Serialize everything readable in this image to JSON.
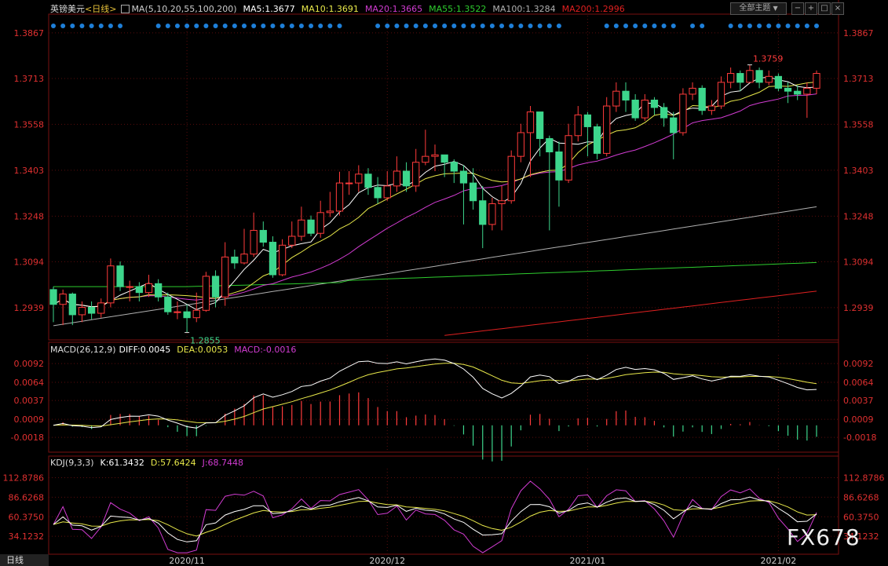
{
  "header": {
    "symbol": "英镑美元",
    "period": "<日线>",
    "ma_label": "MA(5,10,20,55,100,200)",
    "ma5": "MA5:1.3677",
    "ma10": "MA10:1.3691",
    "ma20": "MA20:1.3665",
    "ma55": "MA55:1.3522",
    "ma100": "MA100:1.3284",
    "ma200": "MA200:1.2996",
    "theme_button": "全部主题",
    "theme_arrow": "▼",
    "ctrl_minus": "−",
    "ctrl_plus": "+",
    "ctrl_max": "□",
    "ctrl_close": "×"
  },
  "macd_header": {
    "name": "MACD(26,12,9)",
    "diff": "DIFF:0.0045",
    "dea": "DEA:0.0053",
    "macd": "MACD:-0.0016"
  },
  "kdj_header": {
    "name": "KDJ(9,3,3)",
    "k": "K:61.3432",
    "d": "D:57.6424",
    "j": "J:68.7448"
  },
  "bottom_tab": "日线",
  "watermark": "FX678",
  "colors": {
    "up": "#ff3b3b",
    "down": "#3dd68c",
    "ma5": "#ffffff",
    "ma10": "#e8e84a",
    "ma20": "#d23cd2",
    "ma55": "#2ecc2e",
    "ma100": "#b0b0b0",
    "ma200": "#e02020",
    "dots": "#1e7fd8",
    "grid": "#7a1010",
    "axis_text": "#e03030"
  },
  "chart_data": {
    "type": "candlestick",
    "price_axis": {
      "ticks": [
        1.3867,
        1.3713,
        1.3558,
        1.3403,
        1.3248,
        1.3094,
        1.2939
      ],
      "tick_labels": [
        "1.3867",
        "1.3713",
        "1.3558",
        "1.3403",
        "1.3248",
        "1.3094",
        "1.2939"
      ],
      "ylim": [
        1.283,
        1.3925
      ]
    },
    "x_labels": [
      {
        "label": "2020/11",
        "index": 14
      },
      {
        "label": "2020/12",
        "index": 35
      },
      {
        "label": "2021/01",
        "index": 56
      },
      {
        "label": "2021/02",
        "index": 76
      }
    ],
    "annotations": [
      {
        "text": "1.2855",
        "type": "low"
      },
      {
        "text": "1.3759",
        "type": "high"
      }
    ],
    "candles": [
      [
        1.3,
        1.295,
        1.301,
        1.289
      ],
      [
        1.295,
        1.2985,
        1.3,
        1.288
      ],
      [
        1.2985,
        1.2915,
        1.299,
        1.288
      ],
      [
        1.2915,
        1.294,
        1.296,
        1.289
      ],
      [
        1.294,
        1.292,
        1.296,
        1.29
      ],
      [
        1.292,
        1.2955,
        1.297,
        1.2905
      ],
      [
        1.2955,
        1.308,
        1.3105,
        1.294
      ],
      [
        1.308,
        1.301,
        1.3095,
        1.2995
      ],
      [
        1.301,
        1.301,
        1.303,
        1.296
      ],
      [
        1.301,
        1.299,
        1.3025,
        1.296
      ],
      [
        1.299,
        1.302,
        1.305,
        1.2975
      ],
      [
        1.302,
        1.2975,
        1.3035,
        1.296
      ],
      [
        1.2975,
        1.2925,
        1.299,
        1.2915
      ],
      [
        1.2925,
        1.2925,
        1.296,
        1.29
      ],
      [
        1.2925,
        1.2905,
        1.295,
        1.2855
      ],
      [
        1.2905,
        1.293,
        1.299,
        1.289
      ],
      [
        1.293,
        1.3045,
        1.306,
        1.2925
      ],
      [
        1.3045,
        1.2975,
        1.3065,
        1.294
      ],
      [
        1.2975,
        1.311,
        1.316,
        1.2945
      ],
      [
        1.311,
        1.309,
        1.3135,
        1.307
      ],
      [
        1.309,
        1.312,
        1.3205,
        1.3085
      ],
      [
        1.312,
        1.32,
        1.326,
        1.311
      ],
      [
        1.32,
        1.316,
        1.323,
        1.3145
      ],
      [
        1.316,
        1.305,
        1.318,
        1.304
      ],
      [
        1.305,
        1.315,
        1.317,
        1.3045
      ],
      [
        1.315,
        1.318,
        1.323,
        1.314
      ],
      [
        1.318,
        1.3235,
        1.328,
        1.3165
      ],
      [
        1.3235,
        1.319,
        1.325,
        1.318
      ],
      [
        1.319,
        1.326,
        1.33,
        1.3175
      ],
      [
        1.326,
        1.3265,
        1.333,
        1.3245
      ],
      [
        1.3265,
        1.336,
        1.3398,
        1.325
      ],
      [
        1.336,
        1.336,
        1.34,
        1.332
      ],
      [
        1.336,
        1.339,
        1.342,
        1.333
      ],
      [
        1.339,
        1.3345,
        1.341,
        1.332
      ],
      [
        1.3345,
        1.331,
        1.338,
        1.329
      ],
      [
        1.331,
        1.335,
        1.34,
        1.33
      ],
      [
        1.335,
        1.34,
        1.345,
        1.333
      ],
      [
        1.34,
        1.335,
        1.343,
        1.333
      ],
      [
        1.335,
        1.343,
        1.3475,
        1.333
      ],
      [
        1.343,
        1.345,
        1.354,
        1.342
      ],
      [
        1.345,
        1.3455,
        1.349,
        1.34
      ],
      [
        1.3455,
        1.343,
        1.345,
        1.338
      ],
      [
        1.343,
        1.34,
        1.344,
        1.336
      ],
      [
        1.34,
        1.336,
        1.342,
        1.322
      ],
      [
        1.336,
        1.33,
        1.341,
        1.327
      ],
      [
        1.33,
        1.322,
        1.335,
        1.314
      ],
      [
        1.322,
        1.329,
        1.331,
        1.32
      ],
      [
        1.329,
        1.33,
        1.335,
        1.32
      ],
      [
        1.33,
        1.345,
        1.347,
        1.329
      ],
      [
        1.345,
        1.353,
        1.356,
        1.343
      ],
      [
        1.353,
        1.36,
        1.362,
        1.338
      ],
      [
        1.36,
        1.351,
        1.36,
        1.345
      ],
      [
        1.351,
        1.3465,
        1.352,
        1.32
      ],
      [
        1.3465,
        1.337,
        1.35,
        1.328
      ],
      [
        1.337,
        1.352,
        1.356,
        1.336
      ],
      [
        1.352,
        1.359,
        1.362,
        1.35
      ],
      [
        1.359,
        1.355,
        1.36,
        1.345
      ],
      [
        1.355,
        1.346,
        1.356,
        1.344
      ],
      [
        1.346,
        1.362,
        1.365,
        1.345
      ],
      [
        1.362,
        1.367,
        1.37,
        1.36
      ],
      [
        1.367,
        1.364,
        1.37,
        1.36
      ],
      [
        1.364,
        1.358,
        1.366,
        1.357
      ],
      [
        1.358,
        1.364,
        1.366,
        1.357
      ],
      [
        1.364,
        1.3615,
        1.365,
        1.359
      ],
      [
        1.3615,
        1.358,
        1.363,
        1.355
      ],
      [
        1.358,
        1.353,
        1.36,
        1.344
      ],
      [
        1.353,
        1.366,
        1.368,
        1.352
      ],
      [
        1.366,
        1.368,
        1.37,
        1.364
      ],
      [
        1.368,
        1.3605,
        1.369,
        1.359
      ],
      [
        1.3605,
        1.362,
        1.364,
        1.359
      ],
      [
        1.362,
        1.37,
        1.372,
        1.361
      ],
      [
        1.37,
        1.373,
        1.375,
        1.368
      ],
      [
        1.373,
        1.37,
        1.374,
        1.367
      ],
      [
        1.37,
        1.374,
        1.3759,
        1.37
      ],
      [
        1.374,
        1.37,
        1.375,
        1.368
      ],
      [
        1.37,
        1.372,
        1.374,
        1.369
      ],
      [
        1.372,
        1.368,
        1.373,
        1.367
      ],
      [
        1.368,
        1.367,
        1.37,
        1.363
      ],
      [
        1.367,
        1.366,
        1.369,
        1.364
      ],
      [
        1.366,
        1.368,
        1.37,
        1.358
      ],
      [
        1.368,
        1.373,
        1.374,
        1.366
      ]
    ],
    "macd_axis": {
      "ticks": [
        0.0092,
        0.0064,
        0.0037,
        0.0009,
        -0.0018
      ],
      "tick_labels": [
        "0.0092",
        "0.0064",
        "0.0037",
        "0.0009",
        "-0.0018"
      ],
      "ylim": [
        -0.004,
        0.0105
      ]
    },
    "kdj_axis": {
      "ticks": [
        112.8786,
        86.6268,
        60.375,
        34.1232
      ],
      "tick_labels": [
        "112.8786",
        "86.6268",
        "60.3750",
        "34.1232"
      ],
      "ylim": [
        10,
        125
      ]
    }
  }
}
